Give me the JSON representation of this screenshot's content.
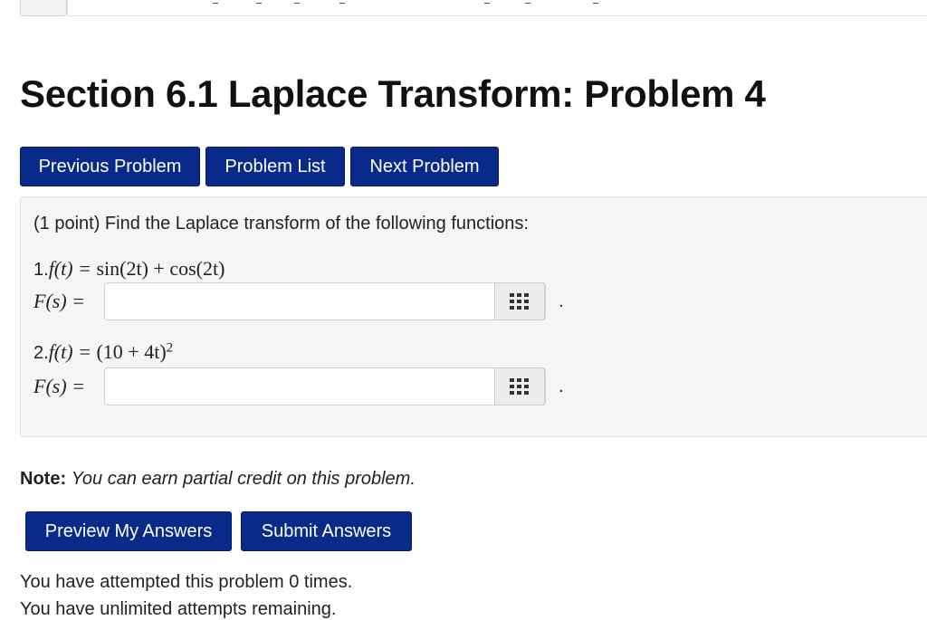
{
  "page_title": "Section 6.1 Laplace Transform: Problem 4",
  "nav": {
    "previous_label": "Previous Problem",
    "list_label": "Problem List",
    "next_label": "Next Problem"
  },
  "problem": {
    "prompt": "(1 point) Find the Laplace transform of the following functions:",
    "items": [
      {
        "number": "1.",
        "lhs": "f(t) =",
        "rhs": "sin(2t) + cos(2t)",
        "answer_label": "F(s) =",
        "answer_value": ""
      },
      {
        "number": "2.",
        "lhs": "f(t) =",
        "rhs": "(10 + 4t)",
        "rhs_sup": "2",
        "answer_label": "F(s) =",
        "answer_value": ""
      }
    ],
    "period": "."
  },
  "note": {
    "label": "Note:",
    "text": "You can earn partial credit on this problem."
  },
  "actions": {
    "preview_label": "Preview My Answers",
    "submit_label": "Submit Answers"
  },
  "status": {
    "attempts": "You have attempted this problem 0 times.",
    "remaining": "You have unlimited attempts remaining."
  },
  "icons": {
    "equation_editor": "grid-icon"
  },
  "colors": {
    "button_bg": "#0a2a8a",
    "box_bg": "#f5f5f5"
  }
}
